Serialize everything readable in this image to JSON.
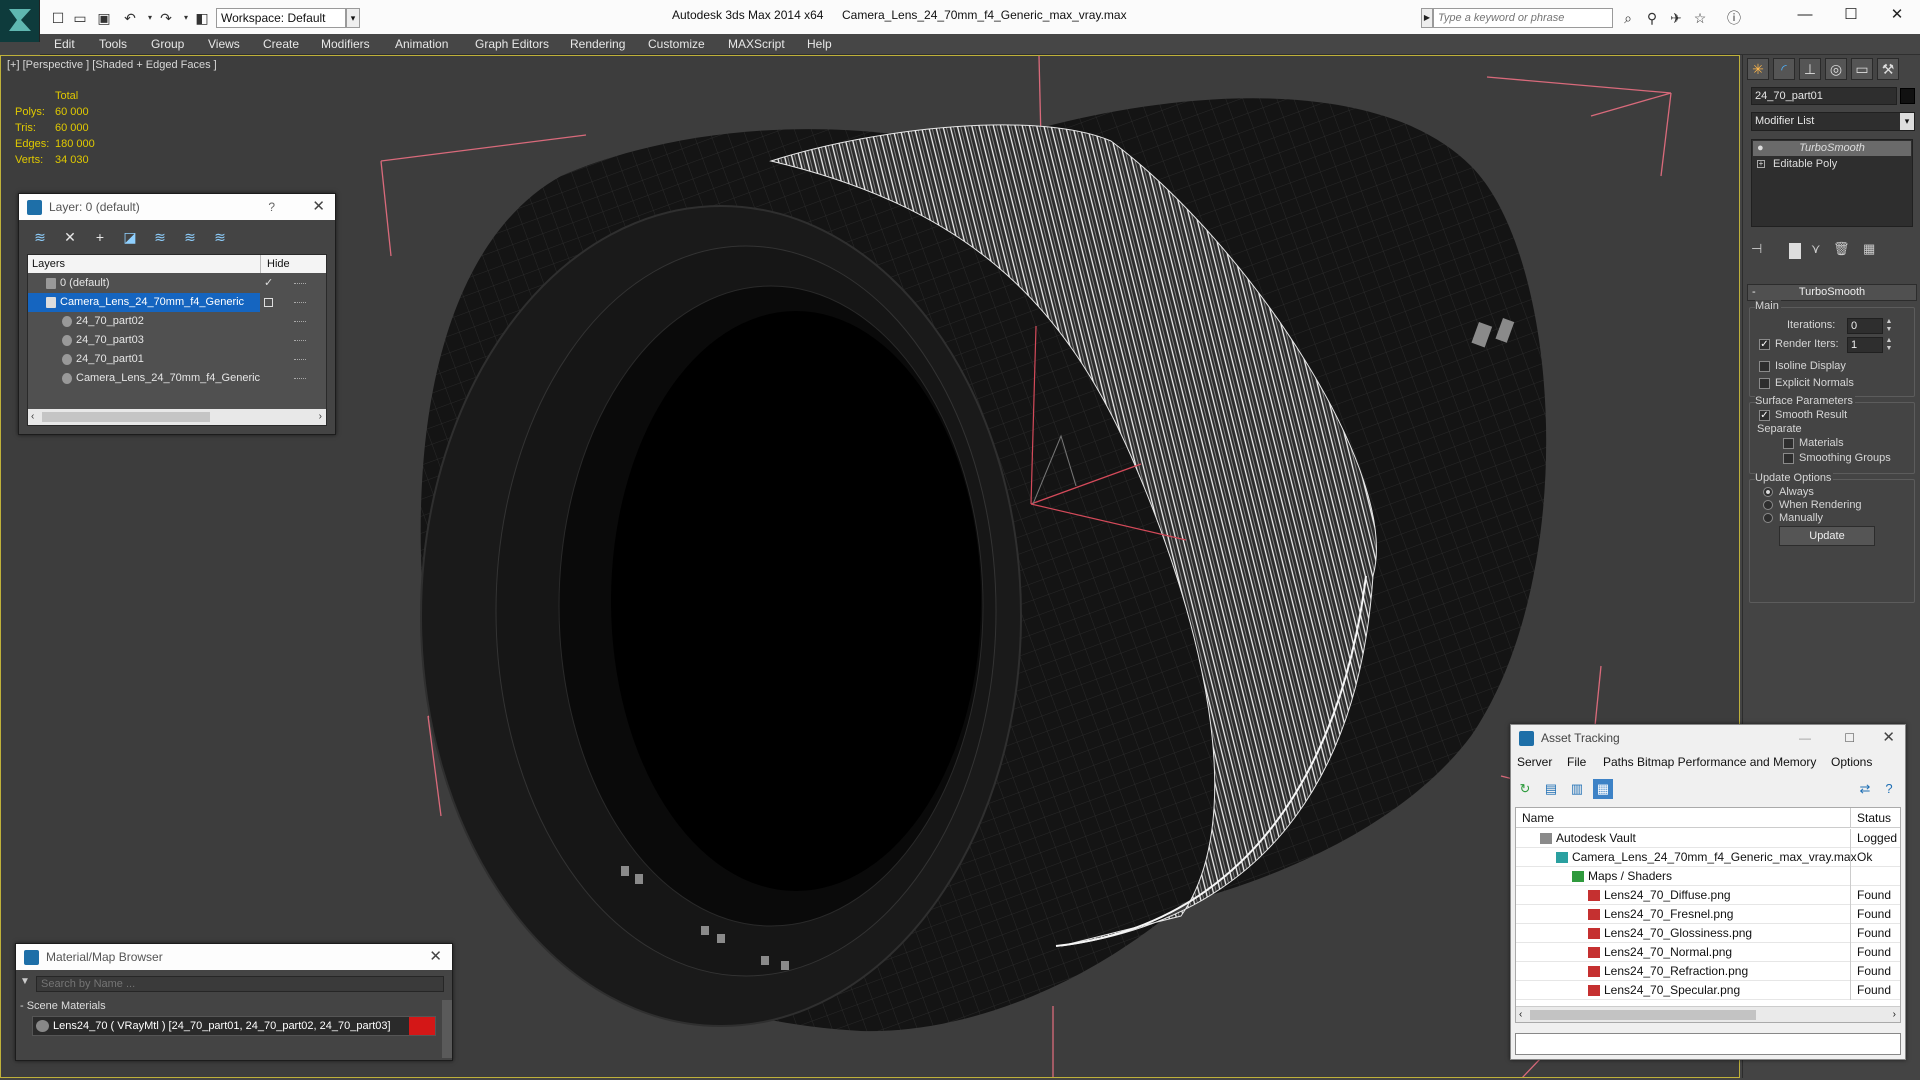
{
  "titlebar": {
    "workspace_label": "Workspace: Default",
    "app_name": "Autodesk 3ds Max  2014 x64",
    "file_name": "Camera_Lens_24_70mm_f4_Generic_max_vray.max",
    "search_placeholder": "Type a keyword or phrase"
  },
  "menu": [
    "Edit",
    "Tools",
    "Group",
    "Views",
    "Create",
    "Modifiers",
    "Animation",
    "Graph Editors",
    "Rendering",
    "Customize",
    "MAXScript",
    "Help"
  ],
  "viewport": {
    "label": "[+] [Perspective ] [Shaded + Edged Faces ]",
    "stats_header": "Total",
    "stats": [
      {
        "label": "Polys:",
        "value": "60 000"
      },
      {
        "label": "Tris:",
        "value": "60 000"
      },
      {
        "label": "Edges:",
        "value": "180 000"
      },
      {
        "label": "Verts:",
        "value": "34 030"
      }
    ]
  },
  "layer_panel": {
    "title": "Layer: 0 (default)",
    "help": "?",
    "col_layers": "Layers",
    "col_hide": "Hide",
    "rows": [
      {
        "name": "0 (default)",
        "indent": 1,
        "selected": false
      },
      {
        "name": "Camera_Lens_24_70mm_f4_Generic",
        "indent": 1,
        "selected": true
      },
      {
        "name": "24_70_part02",
        "indent": 2,
        "selected": false
      },
      {
        "name": "24_70_part03",
        "indent": 2,
        "selected": false
      },
      {
        "name": "24_70_part01",
        "indent": 2,
        "selected": false
      },
      {
        "name": "Camera_Lens_24_70mm_f4_Generic",
        "indent": 2,
        "selected": false
      }
    ]
  },
  "command_panel": {
    "object_name": "24_70_part01",
    "modifier_list": "Modifier List",
    "stack": [
      "TurboSmooth",
      "Editable Poly"
    ],
    "rollout": "TurboSmooth",
    "main_label": "Main",
    "iterations_label": "Iterations:",
    "iterations_value": "0",
    "render_iters_label": "Render Iters:",
    "render_iters_value": "1",
    "isoline": "Isoline Display",
    "explicit": "Explicit Normals",
    "surface_label": "Surface Parameters",
    "smooth_result": "Smooth Result",
    "separate_label": "Separate",
    "materials": "Materials",
    "smoothing_groups": "Smoothing Groups",
    "update_label": "Update Options",
    "always": "Always",
    "when_rendering": "When Rendering",
    "manually": "Manually",
    "update_button": "Update"
  },
  "material_browser": {
    "title": "Material/Map Browser",
    "search_placeholder": "Search by Name ...",
    "section": "- Scene Materials",
    "item": "Lens24_70  ( VRayMtl ) [24_70_part01, 24_70_part02, 24_70_part03]",
    "swatch_color": "#d41717"
  },
  "asset_tracking": {
    "title": "Asset Tracking",
    "menu": [
      "Server",
      "File",
      "Paths",
      "Bitmap Performance and Memory",
      "Options"
    ],
    "col_name": "Name",
    "col_status": "Status",
    "rows": [
      {
        "name": "Autodesk Vault",
        "status": "Logged O",
        "level": 1,
        "icon": "vault"
      },
      {
        "name": "Camera_Lens_24_70mm_f4_Generic_max_vray.max",
        "status": "Ok",
        "level": 2,
        "icon": "max"
      },
      {
        "name": "Maps / Shaders",
        "status": "",
        "level": 3,
        "icon": "maps"
      },
      {
        "name": "Lens24_70_Diffuse.png",
        "status": "Found",
        "level": 4,
        "icon": "png"
      },
      {
        "name": "Lens24_70_Fresnel.png",
        "status": "Found",
        "level": 4,
        "icon": "png"
      },
      {
        "name": "Lens24_70_Glossiness.png",
        "status": "Found",
        "level": 4,
        "icon": "png"
      },
      {
        "name": "Lens24_70_Normal.png",
        "status": "Found",
        "level": 4,
        "icon": "png"
      },
      {
        "name": "Lens24_70_Refraction.png",
        "status": "Found",
        "level": 4,
        "icon": "png"
      },
      {
        "name": "Lens24_70_Specular.png",
        "status": "Found",
        "level": 4,
        "icon": "png"
      }
    ]
  },
  "colors": {
    "stats": "#e0c900",
    "selection": "#1565c0",
    "viewport_border": "#bfb13a"
  }
}
